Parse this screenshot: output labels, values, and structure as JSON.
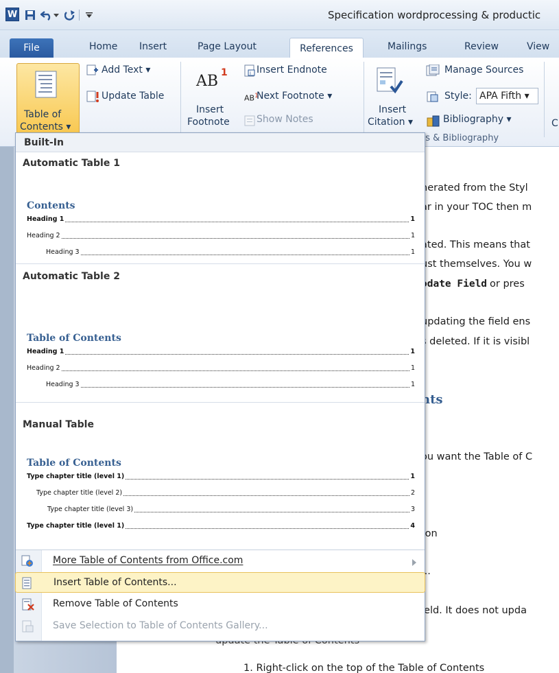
{
  "window": {
    "title": "Specification wordprocessing & productic"
  },
  "qat": {
    "icons": [
      "word-logo",
      "save-icon",
      "undo-icon",
      "redo-icon",
      "customize-qat-icon"
    ],
    "word_letter": "W"
  },
  "tabs": [
    "File",
    "Home",
    "Insert",
    "Page Layout",
    "References",
    "Mailings",
    "Review",
    "View"
  ],
  "ribbon": {
    "toc": {
      "label1": "Table of",
      "label2": "Contents ▾"
    },
    "add_text": "Add Text ▾",
    "update_table": "Update Table",
    "insert_footnote": {
      "label1": "Insert",
      "label2": "Footnote",
      "ab": "AB",
      "sup": "1"
    },
    "insert_endnote": "Insert Endnote",
    "next_footnote": "Next Footnote ▾",
    "show_notes": "Show Notes",
    "insert_citation": {
      "label1": "Insert",
      "label2": "Citation ▾"
    },
    "manage_sources": "Manage Sources",
    "style_label": "Style:",
    "style_value": "APA Fifth ▾",
    "bibliography": "Bibliography ▾",
    "group_label": "ns & Bibliography",
    "c_cut": "C"
  },
  "document": {
    "lines": [
      "nerated from the Styl",
      "ar in your TOC then m",
      "ated. This means that",
      "ust themselves. You w",
      "odate Field",
      " or pres",
      "updating the field ens",
      "s deleted. If it is visibl",
      "nts",
      "ou want the Table of C",
      "ton",
      "...",
      "ield. It does not upda",
      "update the Table of Contents",
      "1.   Right-click on the top of the Table of Contents"
    ]
  },
  "dropdown": {
    "builtin_label": "Built-In",
    "galleries": [
      {
        "title": "Automatic Table 1",
        "heading": "Contents",
        "rows": [
          {
            "text": "Heading 1",
            "page": "1",
            "bold": true,
            "indent": 0
          },
          {
            "text": "Heading 2",
            "page": "1",
            "bold": false,
            "indent": 0
          },
          {
            "text": "Heading 3",
            "page": "1",
            "bold": false,
            "indent": 1
          }
        ]
      },
      {
        "title": "Automatic Table 2",
        "heading": "Table of Contents",
        "rows": [
          {
            "text": "Heading 1",
            "page": "1",
            "bold": true,
            "indent": 0
          },
          {
            "text": "Heading 2",
            "page": "1",
            "bold": false,
            "indent": 0
          },
          {
            "text": "Heading 3",
            "page": "1",
            "bold": false,
            "indent": 1
          }
        ]
      },
      {
        "title": "Manual Table",
        "heading": "Table of Contents",
        "rows": [
          {
            "text": "Type chapter title (level 1)",
            "page": "1",
            "bold": true,
            "indent": 0
          },
          {
            "text": "Type chapter title (level 2)",
            "page": "2",
            "bold": false,
            "indent": 1
          },
          {
            "text": "Type chapter title (level 3)",
            "page": "3",
            "bold": false,
            "indent": 2
          },
          {
            "text": "Type chapter title (level 1)",
            "page": "4",
            "bold": true,
            "indent": 0
          }
        ]
      }
    ],
    "menu": [
      {
        "label": "More Table of Contents from Office.com",
        "key": "M",
        "submenu": true,
        "state": "normal"
      },
      {
        "label": "Insert Table of Contents...",
        "key": "I",
        "submenu": false,
        "state": "highlighted"
      },
      {
        "label": "Remove Table of Contents",
        "key": "R",
        "submenu": false,
        "state": "normal"
      },
      {
        "label": "Save Selection to Table of Contents Gallery...",
        "key": "S",
        "submenu": false,
        "state": "disabled"
      }
    ]
  },
  "colors": {
    "accent": "#2b5797",
    "highlight": "#fdf3c6",
    "toc_heading": "#365f91"
  }
}
